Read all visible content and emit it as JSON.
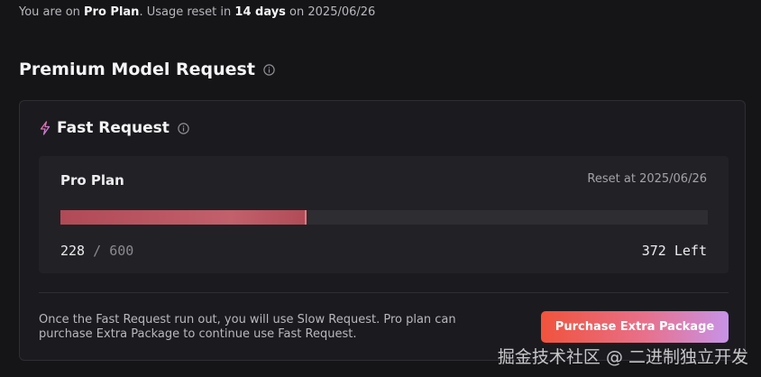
{
  "header": {
    "prefix": "You are on ",
    "plan": "Pro Plan",
    "middle": ". Usage reset in ",
    "days": "14 days",
    "suffix": " on 2025/06/26"
  },
  "section": {
    "title": "Premium Model Request",
    "info_icon": "info-icon"
  },
  "card": {
    "title": "Fast Request",
    "title_icon": "lightning-icon",
    "info_icon": "info-icon",
    "plan_name": "Pro Plan",
    "reset": "Reset at 2025/06/26",
    "usage": {
      "used": "228",
      "separator": "/",
      "total": "600",
      "left": "372 Left",
      "fraction": 0.38
    },
    "note": "Once the Fast Request run out, you will use Slow Request. Pro plan can purchase Extra Package to continue use Fast Request.",
    "purchase_label": "Purchase Extra Package"
  },
  "watermark": "掘金技术社区 @ 二进制独立开发",
  "colors": {
    "accent_start": "#f0533c",
    "accent_end": "#c793e8",
    "progress": "#c2606b"
  }
}
